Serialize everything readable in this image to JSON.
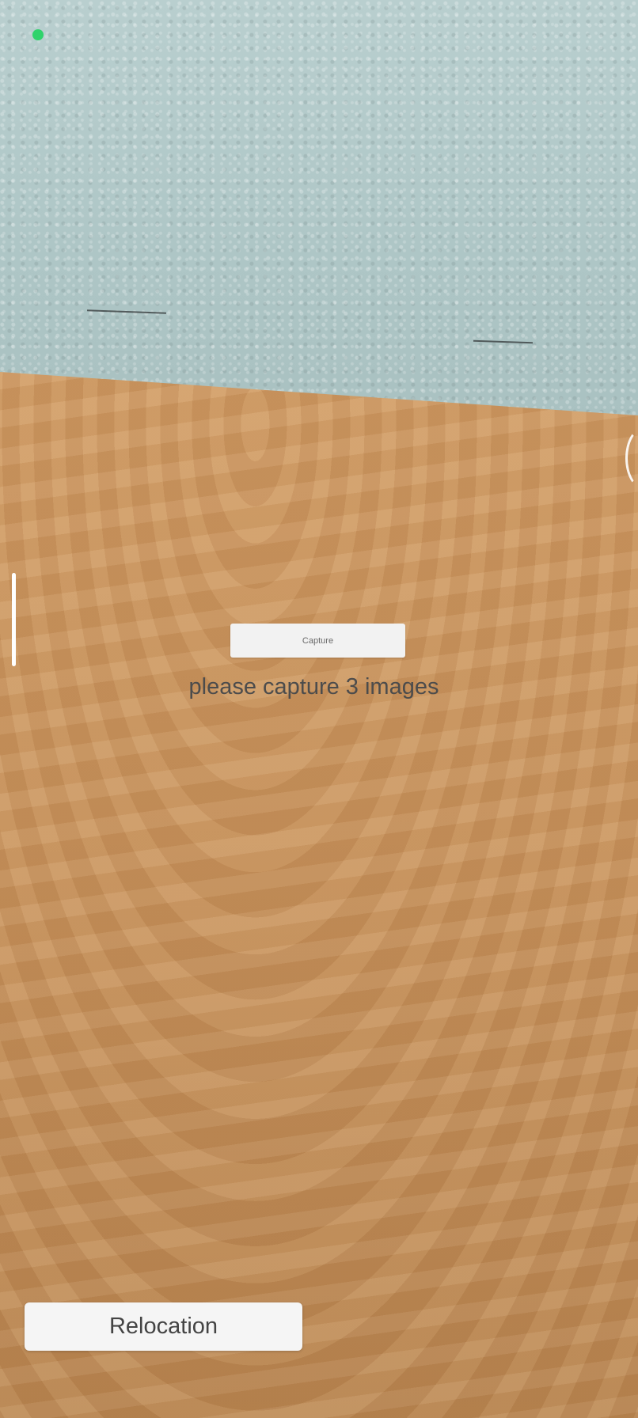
{
  "ar_view": {
    "status_dot_color": "#2fd36b",
    "capture_button": {
      "label": "Capture"
    },
    "instruction_text": "please capture 3 images",
    "relocation_button": {
      "label": "Relocation"
    }
  }
}
